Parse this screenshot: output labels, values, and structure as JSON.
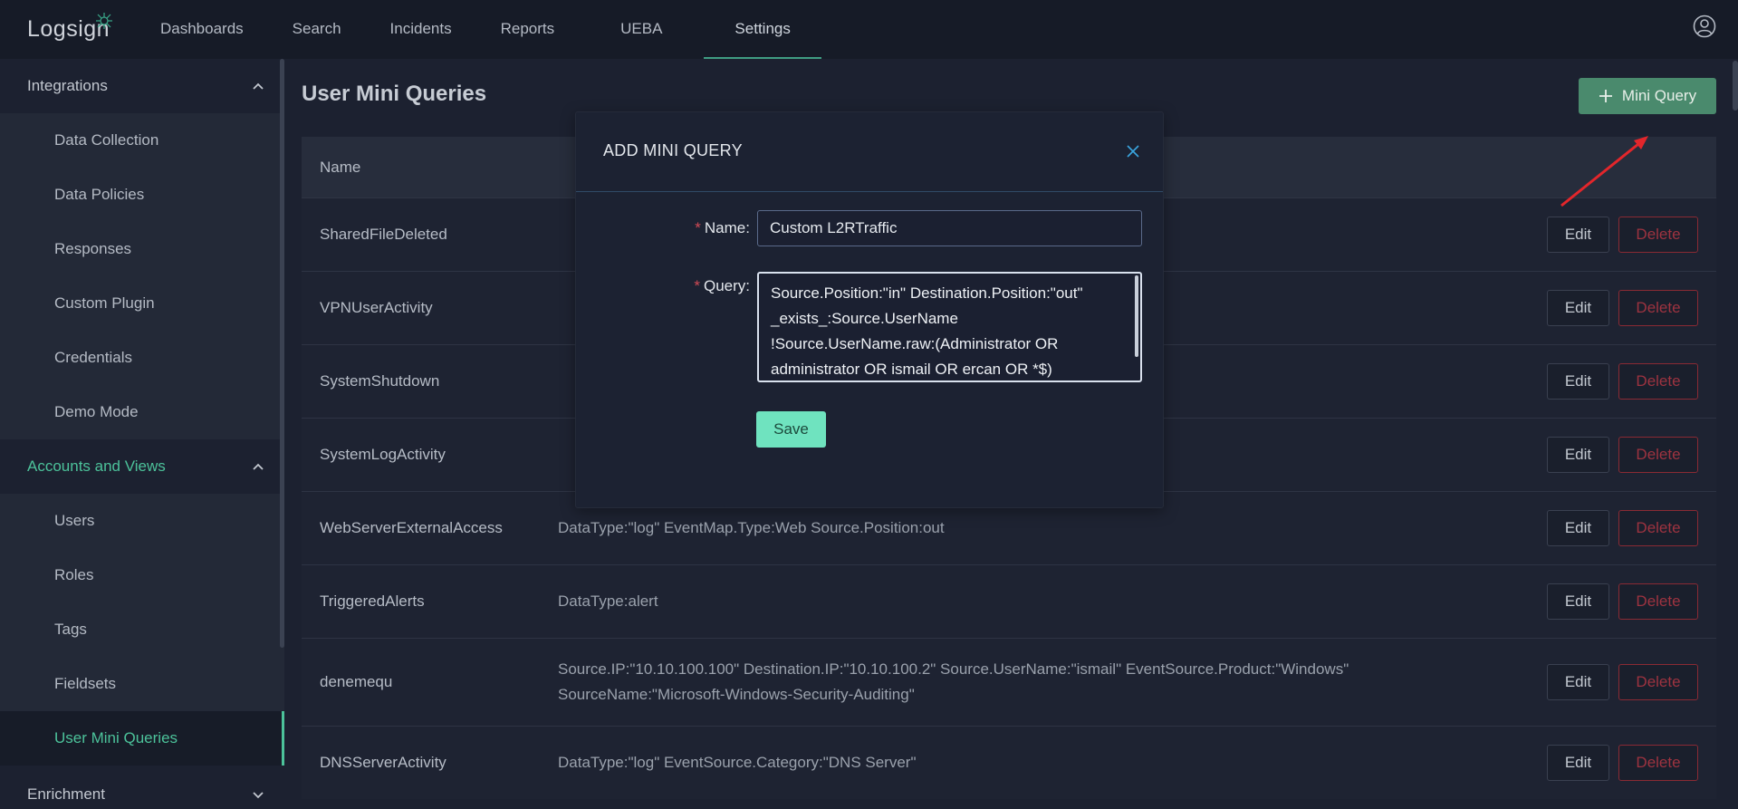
{
  "app": {
    "logo_text": "Logsign"
  },
  "nav": {
    "items": [
      "Dashboards",
      "Search",
      "Incidents",
      "Reports",
      "UEBA",
      "Settings"
    ],
    "active": "Settings"
  },
  "sidebar": {
    "sections": [
      {
        "label": "Integrations",
        "expanded": true,
        "items": [
          "Data Collection",
          "Data Policies",
          "Responses",
          "Custom Plugin",
          "Credentials",
          "Demo Mode"
        ]
      },
      {
        "label": "Accounts and Views",
        "expanded": true,
        "items": [
          "Users",
          "Roles",
          "Tags",
          "Fieldsets",
          "User Mini Queries"
        ]
      },
      {
        "label": "Enrichment",
        "expanded": false,
        "items": []
      }
    ],
    "active_item": "User Mini Queries"
  },
  "main": {
    "title": "User Mini Queries",
    "add_button_label": "Mini Query",
    "table": {
      "header_name": "Name",
      "rows": [
        {
          "name": "SharedFileDeleted",
          "query": ""
        },
        {
          "name": "VPNUserActivity",
          "query": ""
        },
        {
          "name": "SystemShutdown",
          "query": ""
        },
        {
          "name": "SystemLogActivity",
          "query": ""
        },
        {
          "name": "WebServerExternalAccess",
          "query": "DataType:\"log\" EventMap.Type:Web Source.Position:out"
        },
        {
          "name": "TriggeredAlerts",
          "query": "DataType:alert"
        },
        {
          "name": "denemequ",
          "query": "Source.IP:\"10.10.100.100\" Destination.IP:\"10.10.100.2\" Source.UserName:\"ismail\" EventSource.Product:\"Windows\" SourceName:\"Microsoft-Windows-Security-Auditing\""
        },
        {
          "name": "DNSServerActivity",
          "query": "DataType:\"log\" EventSource.Category:\"DNS Server\""
        }
      ],
      "edit_label": "Edit",
      "delete_label": "Delete"
    }
  },
  "modal": {
    "title": "ADD MINI QUERY",
    "name_label": "Name",
    "name_value": "Custom L2RTraffic",
    "query_label": "Query",
    "query_value": "Source.Position:\"in\" Destination.Position:\"out\"\n_exists_:Source.UserName\n!Source.UserName.raw:(Administrator OR\nadministrator OR ismail OR ercan OR *$)",
    "save_label": "Save"
  },
  "colors": {
    "accent": "#4cc29a",
    "primary_button": "#4a8a6d",
    "save_button": "#6fe3bf",
    "danger": "#9e3340",
    "background": "#1c2130"
  }
}
